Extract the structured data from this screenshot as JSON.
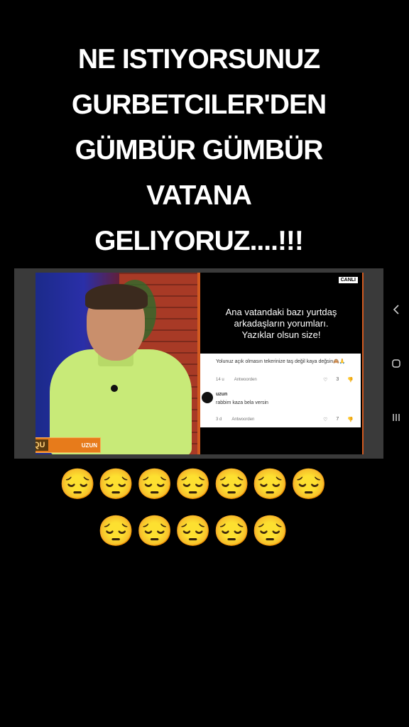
{
  "headline": {
    "line1": "NE ISTIYORSUNUZ",
    "line2": "GURBETCILER'DEN",
    "line3": "GÜMBÜR GÜMBÜR",
    "line4": "VATANA",
    "line5": "GELIYORUZ....!!!"
  },
  "video": {
    "live_badge": "CANLI",
    "lower_third_logo": "QU",
    "lower_third_name": "UZUN",
    "panel_heading": {
      "line1": "Ana vatandaki bazı yurtdaş",
      "line2": "arkadaşların yorumları.",
      "line3": "Yazıklar olsun size!"
    },
    "comments": [
      {
        "text": "Yolunuz açık olmasın tekerinize taş değil kaya değsin🙈🙏",
        "age": "14 u",
        "reply": "Antwoorden",
        "likes": "3"
      },
      {
        "user": "uzun",
        "text": "rabbim kaza bela versin",
        "age": "3 d",
        "reply": "Antwoorden",
        "likes": "7"
      }
    ]
  },
  "system_nav": {
    "back": "back-icon",
    "home": "home-icon",
    "recents": "recents-icon"
  },
  "emojis": {
    "row1": "😔😔😔😔😔😔😔",
    "row2": "😔😔😔😔😔"
  }
}
